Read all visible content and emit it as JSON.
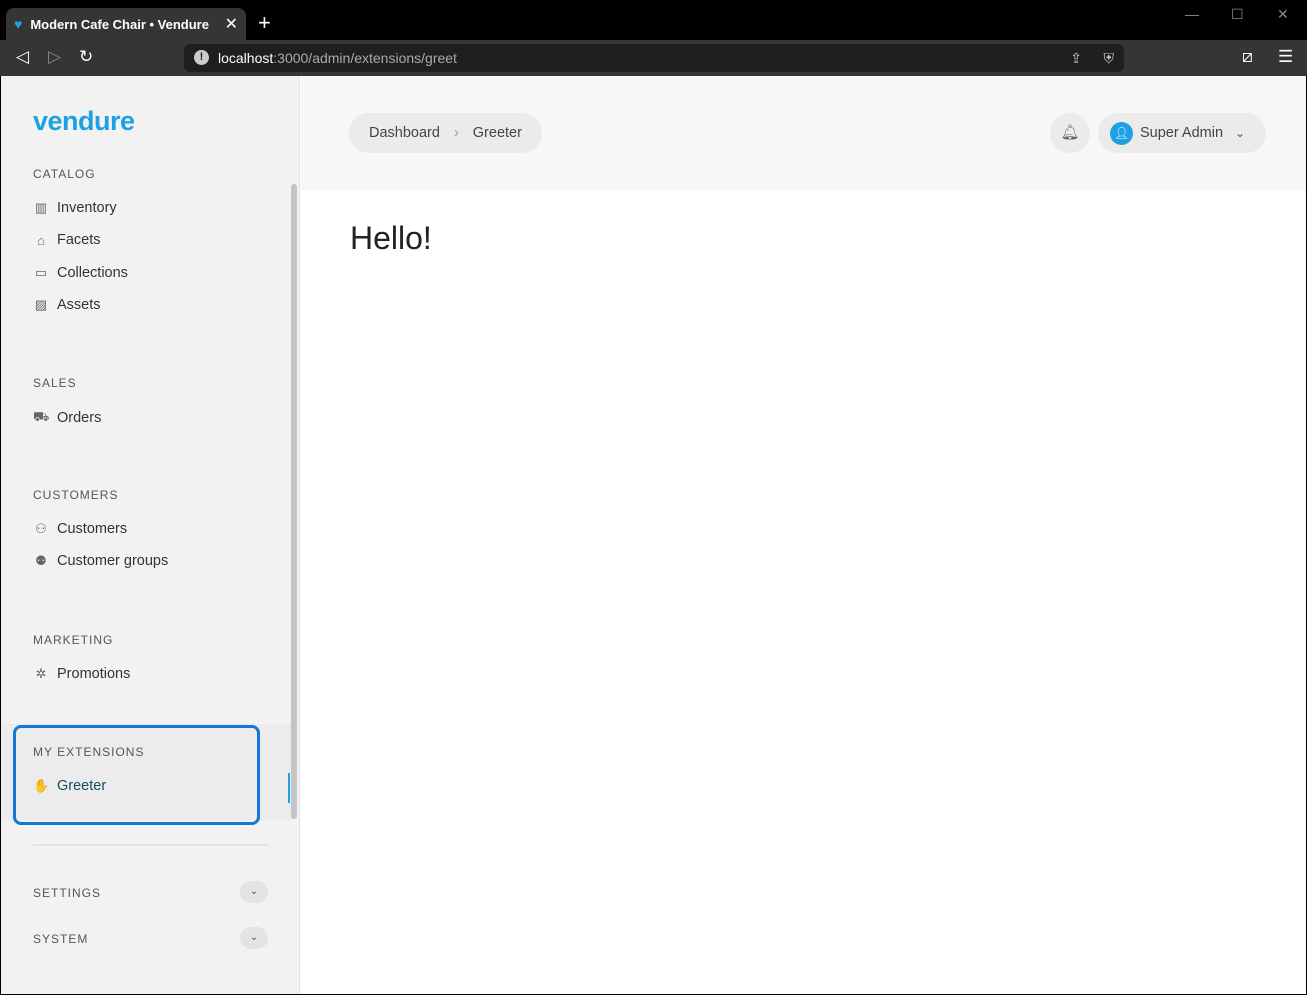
{
  "browser": {
    "tab_title": "Modern Cafe Chair • Vendure",
    "url_host": "localhost",
    "url_path": ":3000/admin/extensions/greet"
  },
  "sidebar": {
    "logo": "vendure",
    "sections": [
      {
        "title": "CATALOG",
        "items": [
          "Inventory",
          "Facets",
          "Collections",
          "Assets"
        ]
      },
      {
        "title": "SALES",
        "items": [
          "Orders"
        ]
      },
      {
        "title": "CUSTOMERS",
        "items": [
          "Customers",
          "Customer groups"
        ]
      },
      {
        "title": "MARKETING",
        "items": [
          "Promotions"
        ]
      },
      {
        "title": "MY EXTENSIONS",
        "items": [
          "Greeter"
        ]
      },
      {
        "title": "SETTINGS"
      },
      {
        "title": "SYSTEM"
      }
    ]
  },
  "header": {
    "breadcrumb": [
      "Dashboard",
      "Greeter"
    ],
    "user": "Super Admin"
  },
  "main": {
    "heading": "Hello!"
  },
  "colors": {
    "accent": "#1da1e2",
    "highlight": "#1479d4"
  }
}
